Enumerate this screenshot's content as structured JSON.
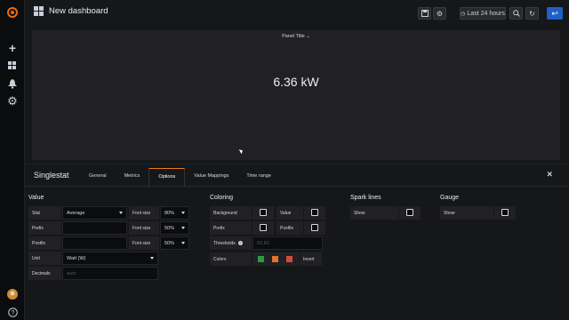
{
  "topbar": {
    "title": "New dashboard",
    "time_range": "Last 24 hours"
  },
  "panel": {
    "title": "Panel Title",
    "value": "6.36 kW"
  },
  "editor": {
    "title": "Singlestat",
    "tabs": [
      "General",
      "Metrics",
      "Options",
      "Value Mappings",
      "Time range"
    ],
    "active_tab": "Options"
  },
  "value_section": {
    "title": "Value",
    "stat_label": "Stat",
    "stat_value": "Average",
    "prefix_label": "Prefix",
    "postfix_label": "Postfix",
    "unit_label": "Unit",
    "unit_value": "Watt (W)",
    "decimals_label": "Decimals",
    "decimals_placeholder": "auto",
    "font_size_label": "Font size",
    "font_sizes": [
      "80%",
      "50%",
      "50%"
    ]
  },
  "coloring": {
    "title": "Coloring",
    "background_label": "Background",
    "value_label": "Value",
    "prefix_label": "Prefix",
    "postfix_label": "Postfix",
    "thresholds_label": "Thresholds",
    "thresholds_placeholder": "50,80",
    "colors_label": "Colors",
    "invert_label": "Invert",
    "colors": [
      "#299c46",
      "#e0752d",
      "#d44a3a"
    ]
  },
  "spark_lines": {
    "title": "Spark lines",
    "show_label": "Show"
  },
  "gauge": {
    "title": "Gauge",
    "show_label": "Show"
  }
}
